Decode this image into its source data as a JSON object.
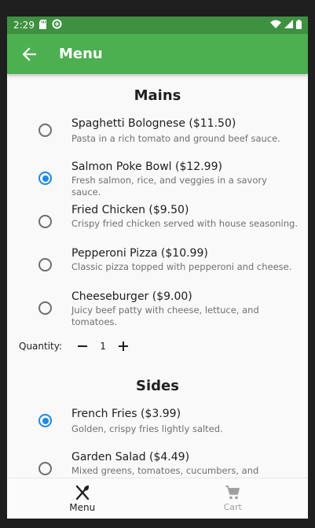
{
  "status_bar": {
    "time": "2:29"
  },
  "app_bar": {
    "title": "Menu"
  },
  "mains": {
    "title": "Mains",
    "items": [
      {
        "name": "Spaghetti Bolognese ($11.50)",
        "desc": "Pasta in a rich tomato and ground beef sauce.",
        "selected": false
      },
      {
        "name": "Salmon Poke Bowl ($12.99)",
        "desc": "Fresh salmon, rice, and veggies in a savory sauce.",
        "selected": true
      },
      {
        "name": "Fried Chicken ($9.50)",
        "desc": "Crispy fried chicken served with house seasoning.",
        "selected": false
      },
      {
        "name": "Pepperoni Pizza ($10.99)",
        "desc": "Classic pizza topped with pepperoni and cheese.",
        "selected": false
      },
      {
        "name": "Cheeseburger ($9.00)",
        "desc": "Juicy beef patty with cheese, lettuce, and tomatoes.",
        "selected": false
      }
    ],
    "quantity_label": "Quantity:",
    "quantity_value": "1"
  },
  "sides": {
    "title": "Sides",
    "items": [
      {
        "name": "French Fries ($3.99)",
        "desc": "Golden, crispy fries lightly salted.",
        "selected": true
      },
      {
        "name": "Garden Salad ($4.49)",
        "desc": "Mixed greens, tomatoes, cucumbers, and",
        "selected": false
      }
    ]
  },
  "bottom_nav": {
    "menu_label": "Menu",
    "cart_label": "Cart"
  },
  "colors": {
    "app_bar": "#4caf50",
    "status_bar": "#3e9140",
    "radio_selected": "#1e88e5"
  }
}
